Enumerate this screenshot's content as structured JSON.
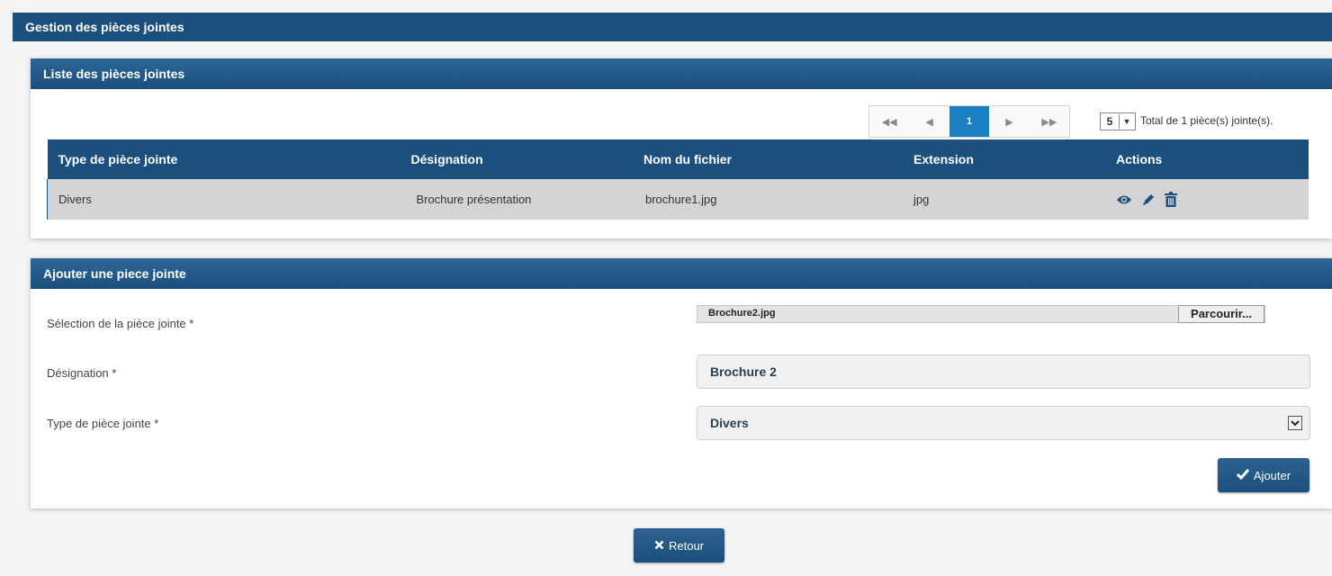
{
  "page_title": "Gestion des pièces jointes",
  "list_panel": {
    "title": "Liste des pièces jointes",
    "paginator": {
      "first_icon": "double-left-icon",
      "prev_icon": "left-icon",
      "current_page": "1",
      "next_icon": "right-icon",
      "last_icon": "double-right-icon"
    },
    "rows_per_page": "5",
    "total_text": "Total de 1 pièce(s) jointe(s).",
    "columns": [
      "Type de pièce jointe",
      "Désignation",
      "Nom du fichier",
      "Extension",
      "Actions"
    ],
    "rows": [
      {
        "type": "Divers",
        "designation": "Brochure présentation",
        "filename": "brochure1.jpg",
        "extension": "jpg"
      }
    ]
  },
  "add_panel": {
    "title": "Ajouter une piece jointe",
    "file_label": "Sélection de la pièce jointe *",
    "file_value": "Brochure2.jpg",
    "browse_label": "Parcourir...",
    "designation_label": "Désignation *",
    "designation_value": "Brochure 2",
    "type_label": "Type de pièce jointe *",
    "type_value": "Divers",
    "add_label": "Ajouter"
  },
  "back_label": "Retour",
  "colors": {
    "header": "#1b4f7d",
    "accent": "#1a7fc1",
    "row": "#d4d4d4"
  }
}
